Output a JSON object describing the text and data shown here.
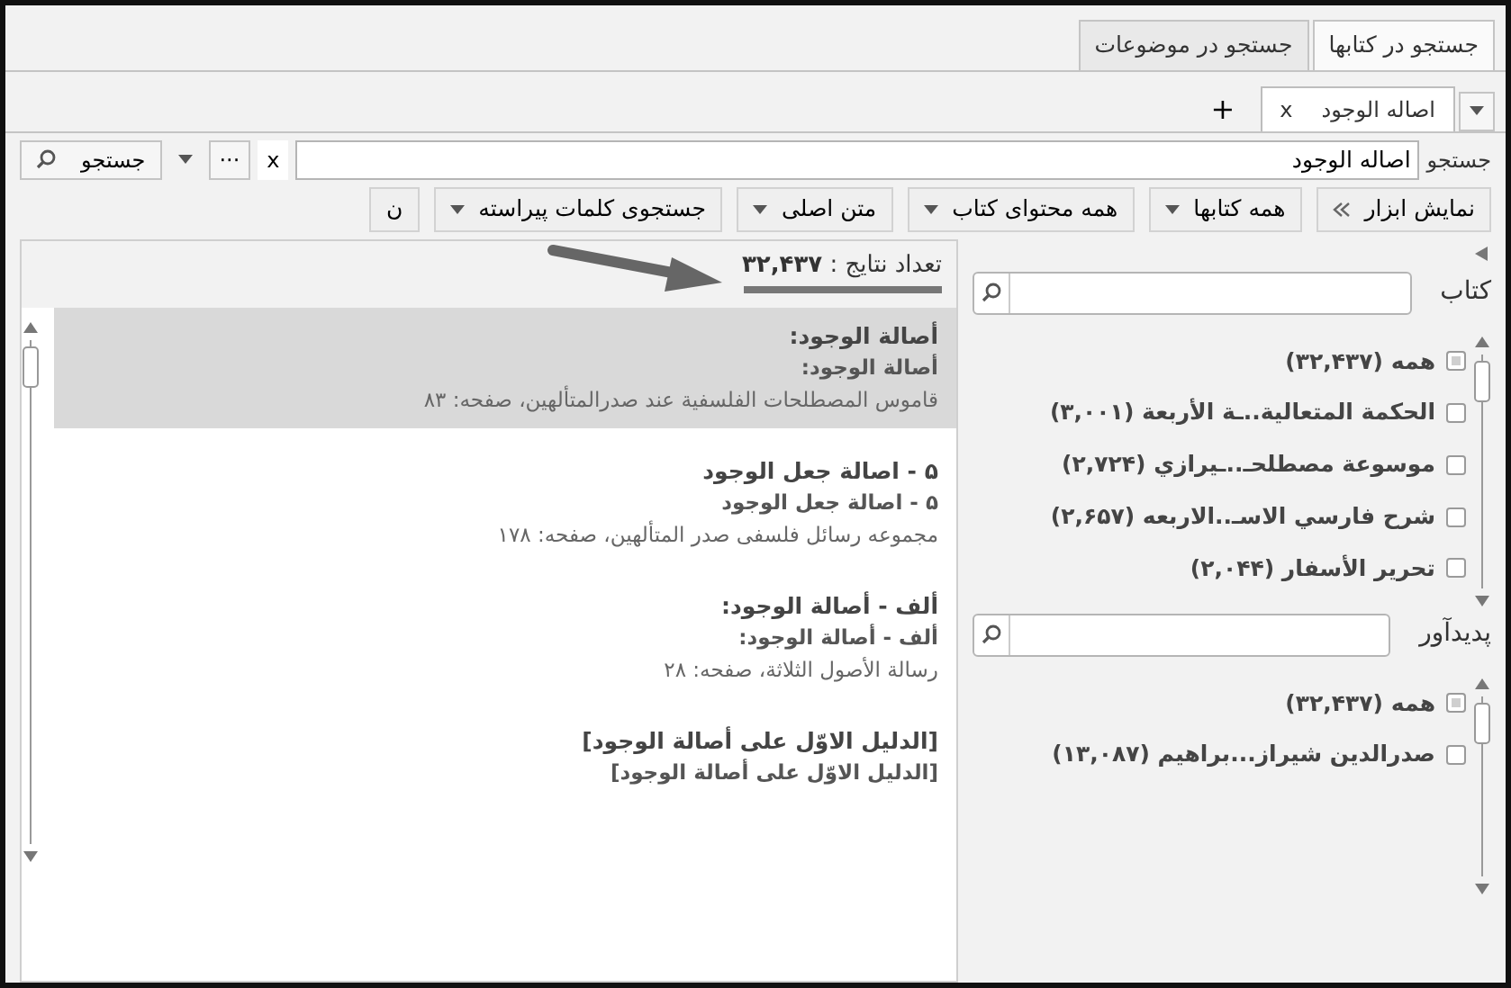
{
  "top_tabs": [
    {
      "label": "جستجو در کتابها",
      "selected": true
    },
    {
      "label": "جستجو در موضوعات",
      "selected": false
    }
  ],
  "doc_tabs": [
    {
      "label": "اصاله الوجود",
      "close": "x",
      "selected": true
    }
  ],
  "add_tab": "+",
  "search_bar": {
    "label": "جستجو",
    "value": "اصاله الوجود",
    "clear": "x",
    "more": "···",
    "button": "جستجو"
  },
  "toolbar": [
    {
      "label": "نمایش ابزار",
      "kind": "toggle"
    },
    {
      "label": "همه کتابها",
      "kind": "dropdown"
    },
    {
      "label": "همه محتوای کتاب",
      "kind": "dropdown"
    },
    {
      "label": "متن اصلی",
      "kind": "dropdown"
    },
    {
      "label": "جستجوی کلمات پیراسته",
      "kind": "dropdown"
    },
    {
      "label": "ن",
      "kind": "plain"
    }
  ],
  "results": {
    "count_label": "تعداد نتایج :",
    "count": "۳۲,۴۳۷",
    "items": [
      {
        "title": "أصالة الوجود:",
        "subtitle": "أصالة الوجود:",
        "source": "قاموس المصطلحات الفلسفية عند صدرالمتألهين، صفحه: ۸۳",
        "selected": true
      },
      {
        "title": "۵ - اصالة جعل الوجود",
        "subtitle": "۵ - اصالة جعل الوجود",
        "source": "مجموعه رسائل فلسفی صدر المتألهین، صفحه: ۱۷۸",
        "selected": false
      },
      {
        "title": "ألف - أصالة الوجود:",
        "subtitle": "ألف - أصالة الوجود:",
        "source": "رسالة الأصول الثلاثة، صفحه: ۲۸",
        "selected": false
      },
      {
        "title": "[الدليل الاوّل على أصالة الوجود]",
        "subtitle": "[الدليل الاوّل على أصالة الوجود]",
        "selected": false
      }
    ]
  },
  "filters": [
    {
      "label": "کتاب",
      "items": [
        {
          "text": "همه (۳۲,۴۳۷)",
          "checked": true
        },
        {
          "text": "الحكمة المتعالية..ـة الأربعة (۳,۰۰۱)",
          "checked": false
        },
        {
          "text": "موسوعة مصطلحـ..ـيرازي (۲,۷۲۴)",
          "checked": false
        },
        {
          "text": "شرح فارسي الاسـ..الاربعه (۲,۶۵۷)",
          "checked": false
        },
        {
          "text": "تحرير الأسفار (۲,۰۴۴)",
          "checked": false
        }
      ]
    },
    {
      "label": "پدیدآور",
      "items": [
        {
          "text": "همه (۳۲,۴۳۷)",
          "checked": true
        },
        {
          "text": "صدرالدين شيراز...براهيم (۱۳,۰۸۷)",
          "checked": false
        }
      ]
    }
  ]
}
